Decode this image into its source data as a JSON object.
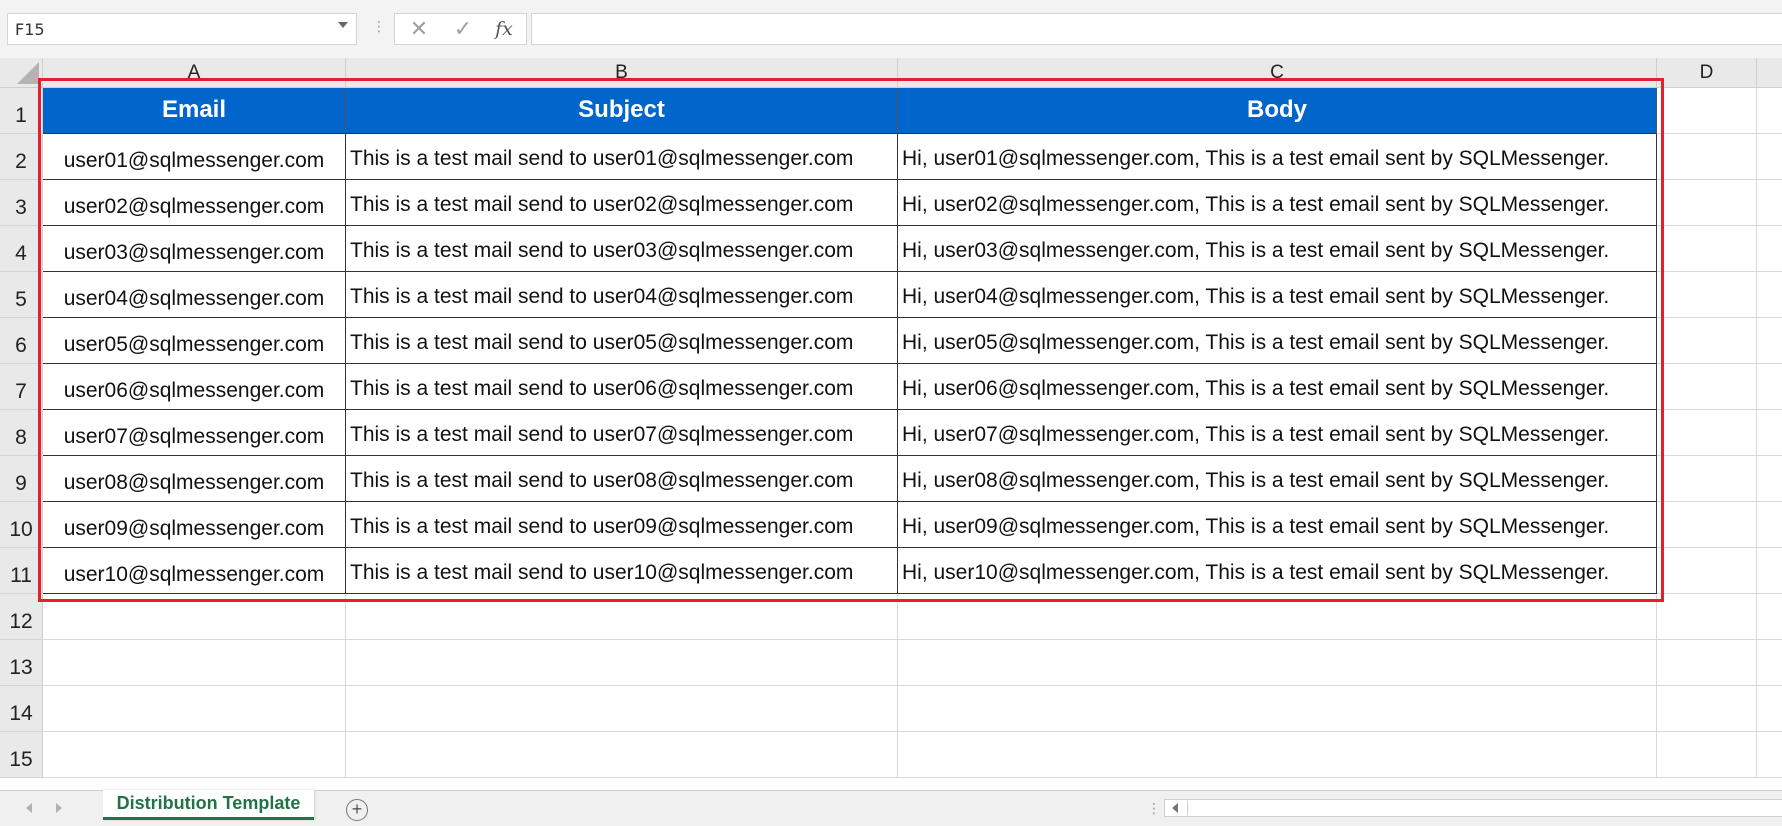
{
  "namebox": {
    "value": "F15"
  },
  "formula_bar": {
    "cancel_icon": "✕",
    "enter_icon": "✓",
    "fx_icon": "fx",
    "formula": ""
  },
  "columns": [
    "A",
    "B",
    "C",
    "D"
  ],
  "rows": [
    "1",
    "2",
    "3",
    "4",
    "5",
    "6",
    "7",
    "8",
    "9",
    "10",
    "11",
    "12",
    "13",
    "14",
    "15"
  ],
  "table": {
    "headers": [
      "Email",
      "Subject",
      "Body"
    ],
    "rows": [
      [
        "user01@sqlmessenger.com",
        "This is a test mail send to user01@sqlmessenger.com",
        "Hi, user01@sqlmessenger.com, This is a test email sent by SQLMessenger."
      ],
      [
        "user02@sqlmessenger.com",
        "This is a test mail send to user02@sqlmessenger.com",
        "Hi, user02@sqlmessenger.com, This is a test email sent by SQLMessenger."
      ],
      [
        "user03@sqlmessenger.com",
        "This is a test mail send to user03@sqlmessenger.com",
        "Hi, user03@sqlmessenger.com, This is a test email sent by SQLMessenger."
      ],
      [
        "user04@sqlmessenger.com",
        "This is a test mail send to user04@sqlmessenger.com",
        "Hi, user04@sqlmessenger.com, This is a test email sent by SQLMessenger."
      ],
      [
        "user05@sqlmessenger.com",
        "This is a test mail send to user05@sqlmessenger.com",
        "Hi, user05@sqlmessenger.com, This is a test email sent by SQLMessenger."
      ],
      [
        "user06@sqlmessenger.com",
        "This is a test mail send to user06@sqlmessenger.com",
        "Hi, user06@sqlmessenger.com, This is a test email sent by SQLMessenger."
      ],
      [
        "user07@sqlmessenger.com",
        "This is a test mail send to user07@sqlmessenger.com",
        "Hi, user07@sqlmessenger.com, This is a test email sent by SQLMessenger."
      ],
      [
        "user08@sqlmessenger.com",
        "This is a test mail send to user08@sqlmessenger.com",
        "Hi, user08@sqlmessenger.com, This is a test email sent by SQLMessenger."
      ],
      [
        "user09@sqlmessenger.com",
        "This is a test mail send to user09@sqlmessenger.com",
        "Hi, user09@sqlmessenger.com, This is a test email sent by SQLMessenger."
      ],
      [
        "user10@sqlmessenger.com",
        "This is a test mail send to user10@sqlmessenger.com",
        "Hi, user10@sqlmessenger.com, This is a test email sent by SQLMessenger."
      ]
    ]
  },
  "sheet_tabs": {
    "active": "Distribution Template",
    "add_icon": "+"
  },
  "colors": {
    "header_fill": "#0066cc",
    "selection_border": "#e3202d",
    "tab_accent": "#217346"
  }
}
